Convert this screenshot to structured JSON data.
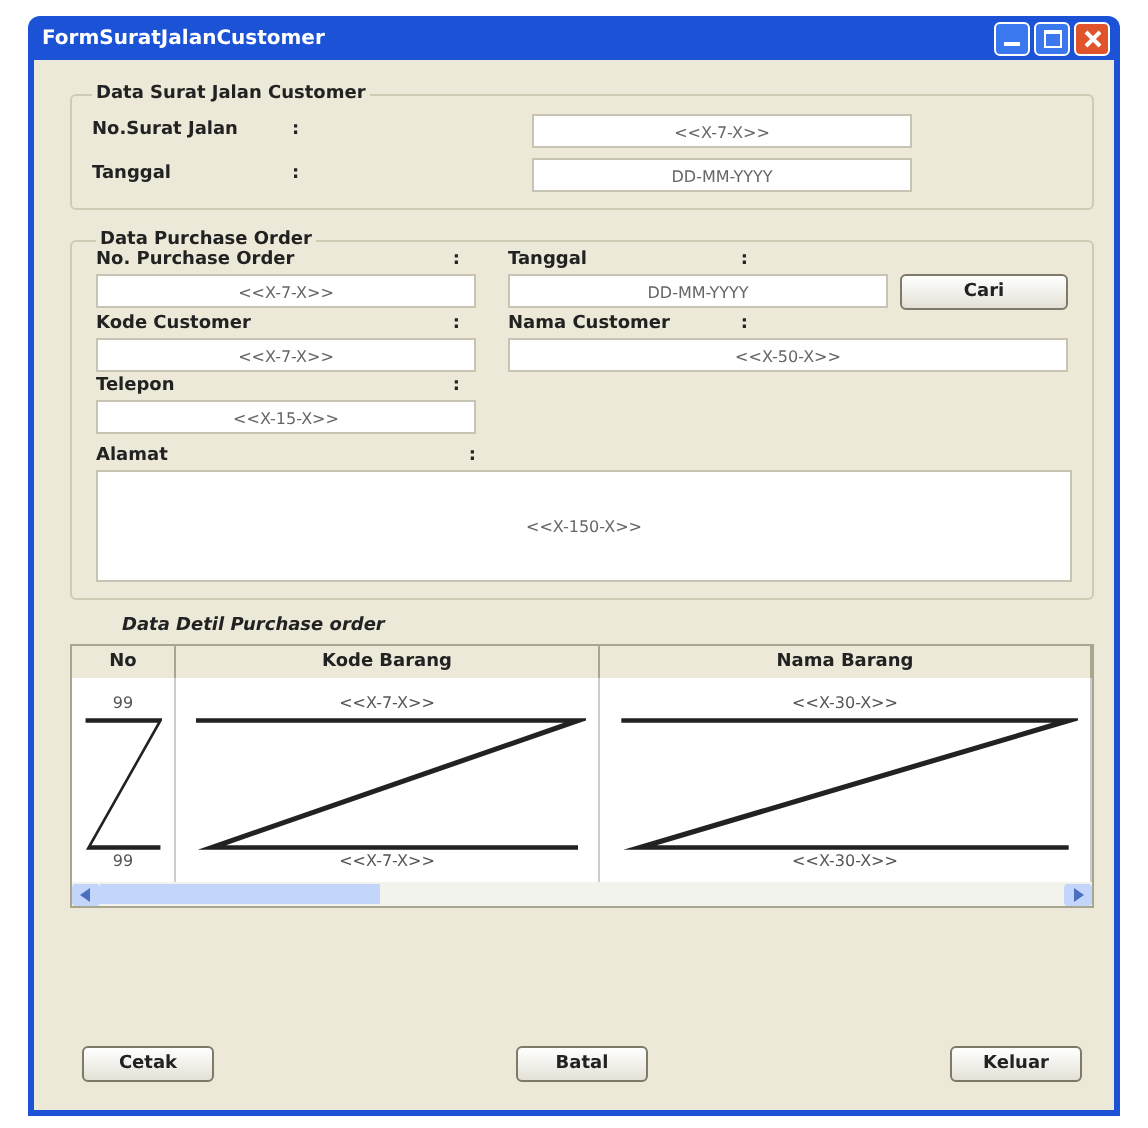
{
  "window": {
    "title": "FormSuratJalanCustomer"
  },
  "surat_jalan": {
    "legend": "Data Surat Jalan Customer",
    "fields": [
      {
        "label": "No.Surat Jalan",
        "colon": ":",
        "value": "<<X-7-X>>"
      },
      {
        "label": "Tanggal",
        "colon": ":",
        "value": "DD-MM-YYYY"
      }
    ]
  },
  "purchase_order": {
    "legend": "Data Purchase Order",
    "no_po": {
      "label": "No. Purchase Order",
      "colon": ":",
      "value": "<<X-7-X>>"
    },
    "tanggal": {
      "label": "Tanggal",
      "colon": ":",
      "value": "DD-MM-YYYY"
    },
    "cari_button": "Cari",
    "kode_customer": {
      "label": "Kode Customer",
      "colon": ":",
      "value": "<<X-7-X>>"
    },
    "nama_customer": {
      "label": "Nama Customer",
      "colon": ":",
      "value": "<<X-50-X>>"
    },
    "telepon": {
      "label": "Telepon",
      "colon": ":",
      "value": "<<X-15-X>>"
    },
    "alamat": {
      "label": "Alamat",
      "colon": ":",
      "value": "<<X-150-X>>"
    }
  },
  "detail": {
    "title": "Data Detil Purchase order",
    "table": {
      "columns": [
        "No",
        "Kode Barang",
        "Nama Barang"
      ],
      "first_row": [
        "99",
        "<<X-7-X>>",
        "<<X-30-X>>"
      ],
      "last_row": [
        "99",
        "<<X-7-X>>",
        "<<X-30-X>>"
      ]
    }
  },
  "buttons": [
    "Cetak",
    "Batal",
    "Keluar"
  ]
}
